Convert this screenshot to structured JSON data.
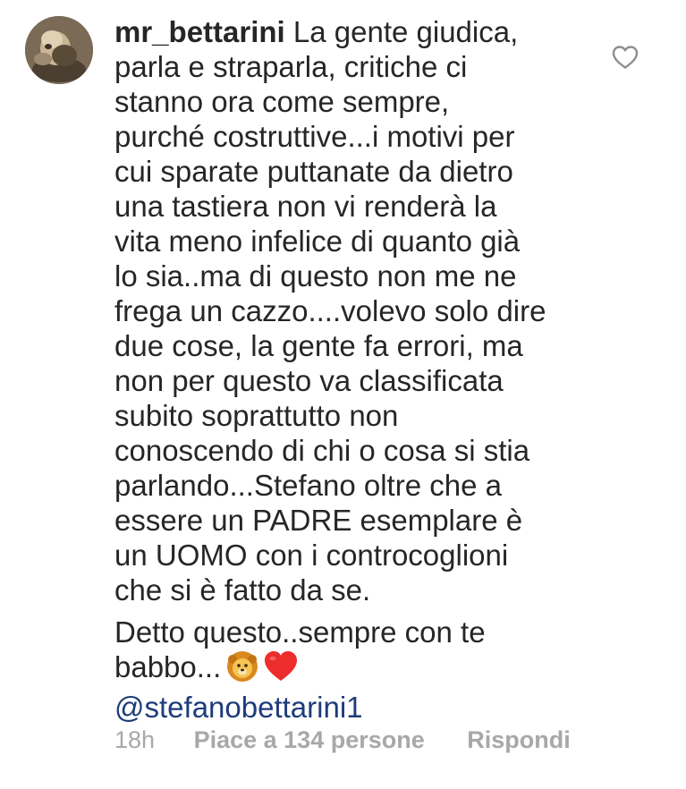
{
  "comment": {
    "username": "mr_bettarini",
    "text_lines": [
      "La gente giudica,",
      "parla e straparla, critiche ci",
      "stanno ora come sempre,",
      "purché costruttive...i motivi per",
      "cui sparate puttanate da dietro",
      "una tastiera non vi renderà la",
      "vita meno infelice di quanto già",
      "lo sia..ma di questo non me ne",
      "frega un cazzo....volevo solo dire",
      "due cose, la gente fa errori, ma",
      "non per questo va classificata",
      "subito soprattutto non",
      "conoscendo di chi o cosa si stia",
      "parlando...Stefano oltre che a",
      "essere un PADRE esemplare è",
      "un UOMO con i controcoglioni",
      "che si è fatto da se."
    ],
    "second_paragraph_lines": [
      "Detto questo..sempre con te",
      "babbo..."
    ],
    "emojis": [
      "lion-emoji",
      "red-heart-emoji"
    ],
    "mention": "@stefanobettarini1",
    "timestamp": "18h",
    "likes": "Piace a 134 persone",
    "reply": "Rispondi",
    "icons": {
      "like": "heart-outline-icon",
      "avatar": "profile-avatar"
    },
    "colors": {
      "text": "#262626",
      "meta": "#a8a8a8",
      "mention": "#1e3c7a",
      "heart": "#ed2c2c"
    }
  }
}
